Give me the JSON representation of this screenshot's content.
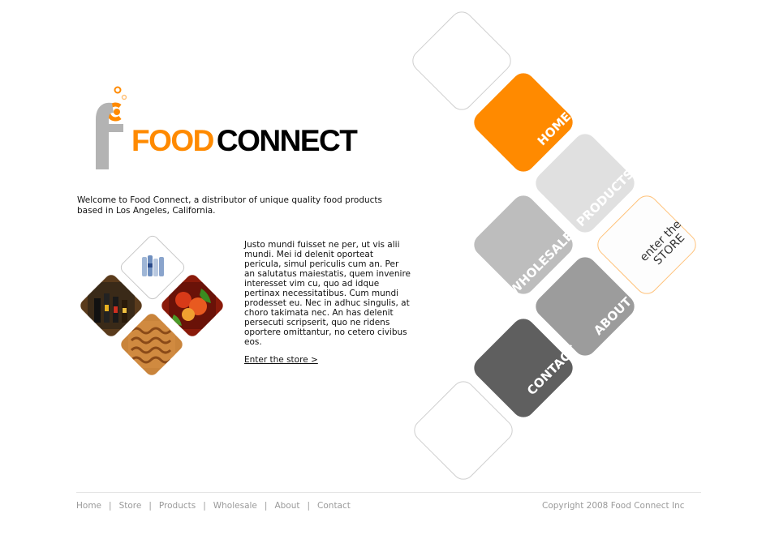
{
  "logo": {
    "food": "FOOD",
    "connect": "CONNECT",
    "accent_color": "#ff8a00",
    "mark_color": "#b3b3b3"
  },
  "intro": "Welcome to Food Connect, a distributor of unique quality food products based in Los Angeles, California.",
  "body_text": "Justo mundi fuisset ne per, ut vis alii mundi. Mei id delenit oporteat pericula, simul periculis cum an. Per an salutatus maiestatis, quem invenire interesset vim cu, quo ad idque pertinax necessitatibus. Cum mundi prodesset eu. Nec in adhuc singulis, at choro takimata nec. An has delenit persecuti scripserit, quo ne ridens oportere omittantur, no cetero civibus eos.",
  "enter_store_link": "Enter the store >",
  "nav_diamonds": {
    "home": "HOME",
    "products": "PRODUCTS",
    "wholesale": "WHOLESALE",
    "about": "ABOUT",
    "contact": "CONTACT",
    "store_line1": "enter the",
    "store_line2": "STORE"
  },
  "footer": {
    "links": [
      "Home",
      "Store",
      "Products",
      "Wholesale",
      "About",
      "Contact"
    ],
    "separator": "|",
    "copyright": "Copyright 2008 Food Connect Inc"
  },
  "images": {
    "water": "water-bottles-image",
    "bottles": "sauce-bottles-image",
    "vegetables": "vegetables-image",
    "pasta": "pasta-image"
  }
}
